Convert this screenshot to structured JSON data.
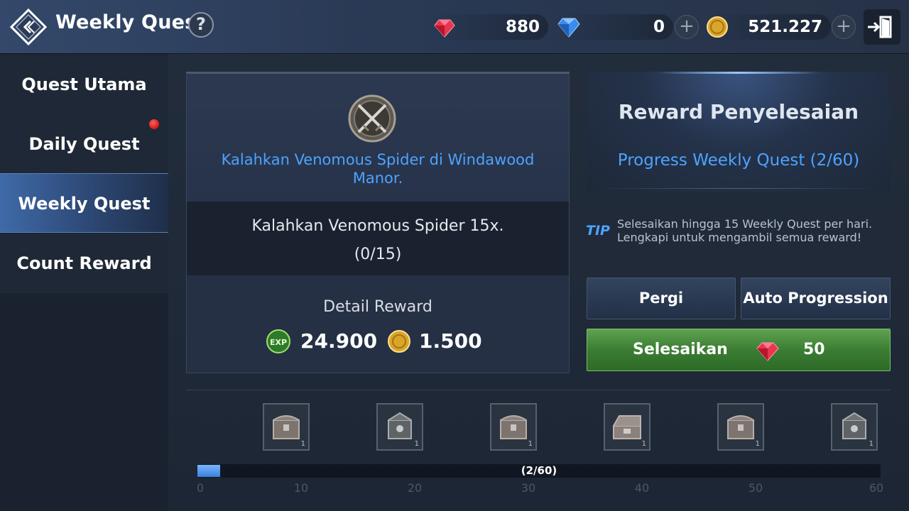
{
  "header": {
    "title": "Weekly Quest",
    "help_label": "?",
    "currencies": [
      {
        "name": "ruby",
        "value": "880",
        "icon": "red-gem-icon",
        "has_plus": false
      },
      {
        "name": "diamond",
        "value": "0",
        "icon": "blue-diamond-icon",
        "has_plus": true
      },
      {
        "name": "gold",
        "value": "521.227",
        "icon": "gold-coin-icon",
        "has_plus": true
      }
    ],
    "plus_label": "+"
  },
  "sidebar": {
    "items": [
      {
        "label": "Quest Utama",
        "active": false
      },
      {
        "label": "Daily Quest",
        "active": false,
        "notification": true
      },
      {
        "label": "Weekly Quest",
        "active": true
      },
      {
        "label": "Count Reward",
        "active": false
      }
    ]
  },
  "quest": {
    "title": "Kalahkan Venomous Spider di Windawood Manor.",
    "objective": "Kalahkan Venomous Spider 15x.",
    "objective_progress": "(0/15)",
    "detail_reward_label": "Detail Reward",
    "rewards": [
      {
        "icon": "exp-orb-icon",
        "value": "24.900"
      },
      {
        "icon": "gold-coin-icon",
        "value": "1.500"
      }
    ]
  },
  "completion": {
    "title": "Reward Penyelesaian",
    "progress_label": "Progress Weekly Quest (2/60)",
    "tip_label": "TIP",
    "tip_text": "Selesaikan hingga 15 Weekly Quest per hari. Lengkapi untuk mengambil semua reward!",
    "go_button": "Pergi",
    "auto_button": "Auto Progression",
    "finish_button": "Selesaikan",
    "finish_cost": "50"
  },
  "progress": {
    "current": 2,
    "max": 60,
    "label": "(2/60)",
    "ticks": [
      "0",
      "10",
      "20",
      "30",
      "40",
      "50",
      "60"
    ],
    "chests": [
      {
        "icon": "silver-chest-icon",
        "count": "1"
      },
      {
        "icon": "ornate-chest-icon",
        "count": "1"
      },
      {
        "icon": "silver-chest-icon",
        "count": "1"
      },
      {
        "icon": "open-chest-icon",
        "count": "1"
      },
      {
        "icon": "silver-chest-icon",
        "count": "1"
      },
      {
        "icon": "ornate-chest-icon",
        "count": "1"
      }
    ]
  },
  "colors": {
    "accent_blue": "#4da3ff",
    "green_button": "#3b7d33",
    "sidebar_active": "#3f6aa8"
  }
}
